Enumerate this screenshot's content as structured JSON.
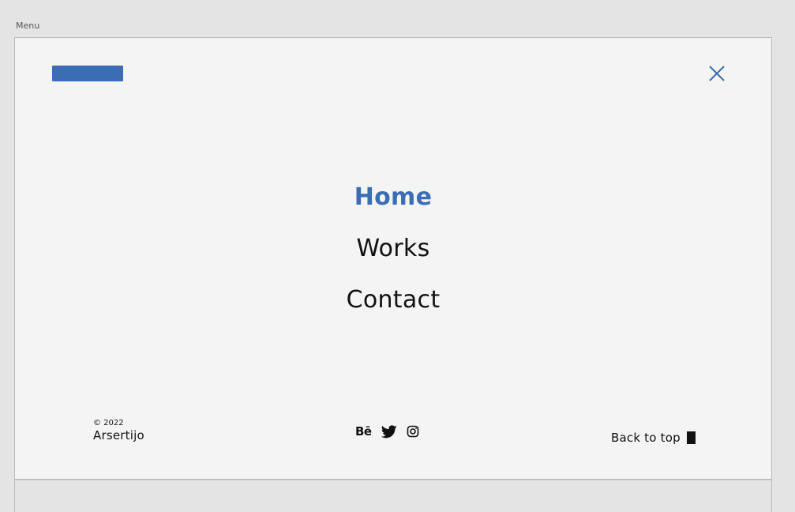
{
  "artboard": {
    "label": "Menu"
  },
  "header": {
    "logo_color": "#3a6db3",
    "close_icon": "close-icon"
  },
  "nav": {
    "items": [
      {
        "label": "Home",
        "active": true
      },
      {
        "label": "Works",
        "active": false
      },
      {
        "label": "Contact",
        "active": false
      }
    ],
    "active_color": "#3a6db3"
  },
  "footer": {
    "copyright": "© 2022",
    "brand": "Arsertijo",
    "socials": [
      {
        "name": "behance-icon",
        "label": "Bē"
      },
      {
        "name": "twitter-icon"
      },
      {
        "name": "instagram-icon"
      }
    ],
    "back_to_top": "Back to top"
  }
}
